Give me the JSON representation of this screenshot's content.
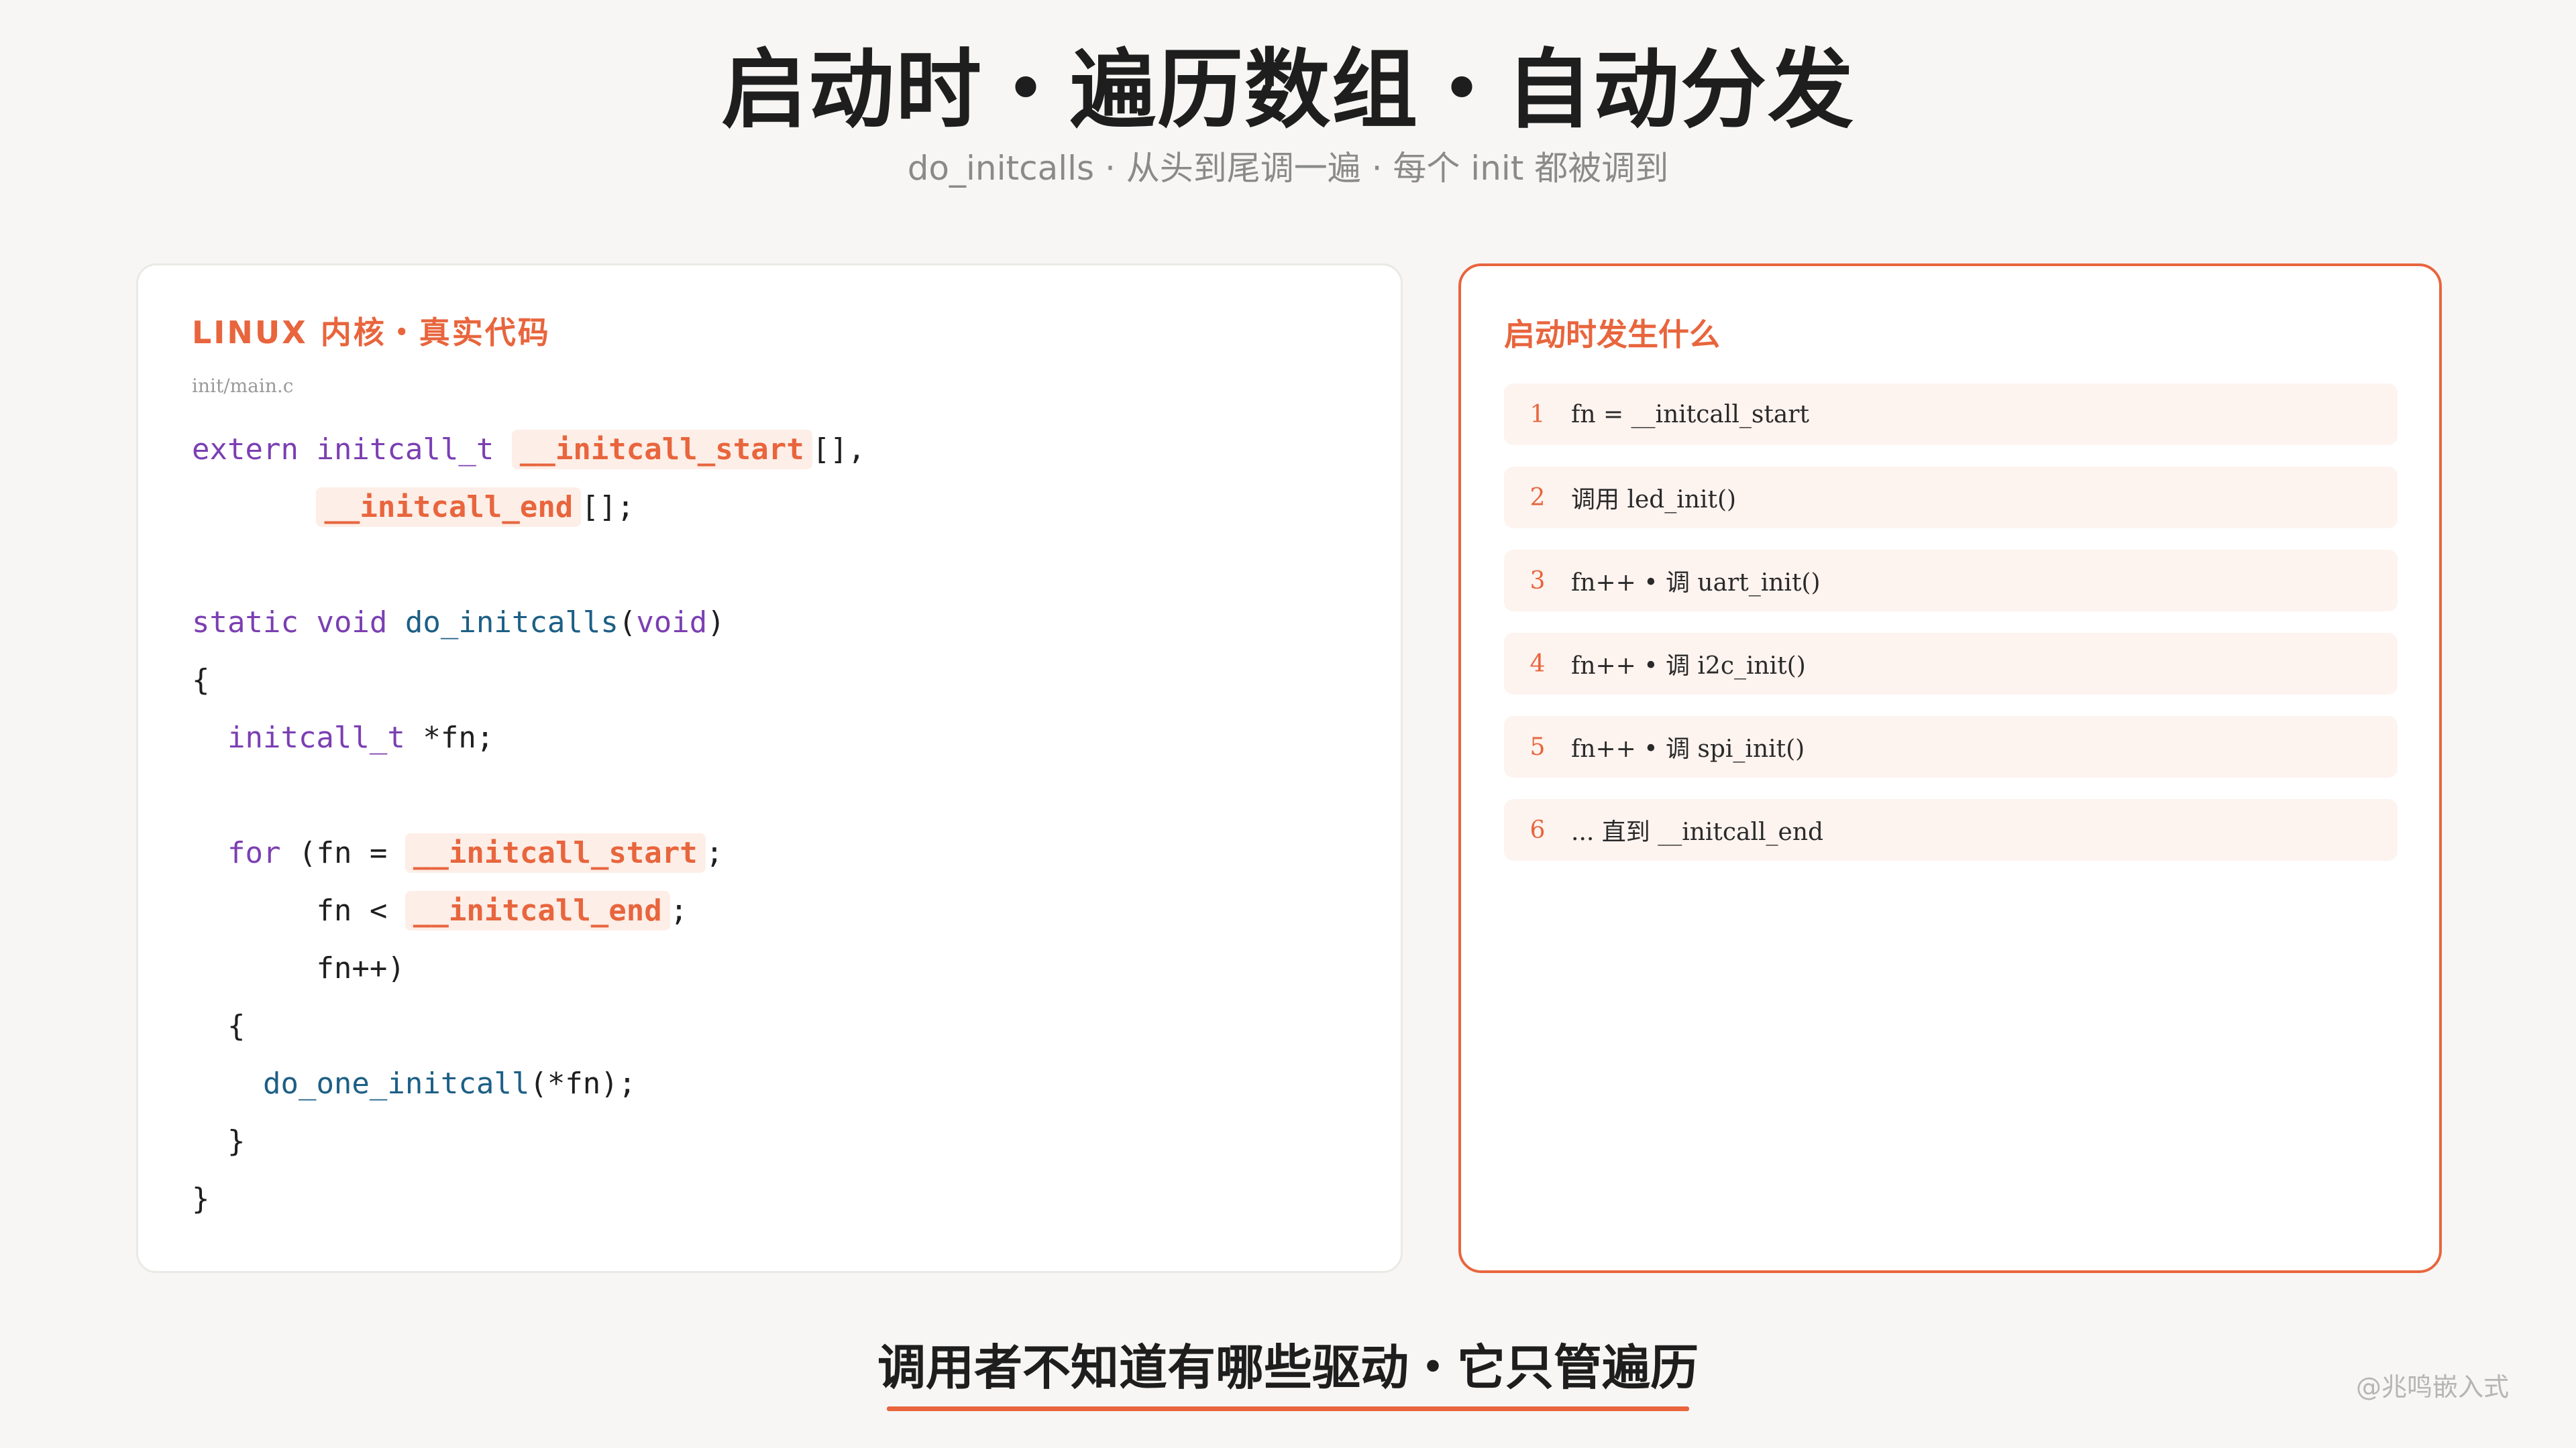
{
  "title": "启动时・遍历数组・自动分发",
  "subtitle": "do_initcalls · 从头到尾调一遍 · 每个 init 都被调到",
  "code_card": {
    "heading": "LINUX 内核・真实代码",
    "file_path": "init/main.c",
    "tokens": {
      "extern": "extern",
      "initcall_t": "initcall_t",
      "initcall_start": "__initcall_start",
      "initcall_end": "__initcall_end",
      "array_comma": "[],",
      "array_semi": "[];",
      "static": "static",
      "void": "void",
      "do_initcalls": "do_initcalls",
      "open_paren": "(",
      "close_paren": ")",
      "open_brace": "{",
      "close_brace": "}",
      "star_fn_semi": "*fn;",
      "for": "for",
      "for_open": "(fn =",
      "semicolon": ";",
      "fn_lt": "fn <",
      "fn_inc": "fn++)",
      "do_one_initcall": "do_one_initcall",
      "call_args": "(*fn);"
    }
  },
  "steps_card": {
    "heading": "启动时发生什么",
    "steps": [
      {
        "num": "1",
        "text": "fn = __initcall_start"
      },
      {
        "num": "2",
        "text": "调用 led_init()"
      },
      {
        "num": "3",
        "text": "fn++ • 调 uart_init()"
      },
      {
        "num": "4",
        "text": "fn++ • 调 i2c_init()"
      },
      {
        "num": "5",
        "text": "fn++ • 调 spi_init()"
      },
      {
        "num": "6",
        "text": "... 直到 __initcall_end"
      }
    ]
  },
  "bottom_text": "调用者不知道有哪些驱动・它只管遍历",
  "watermark": "@兆鸣嵌入式",
  "colors": {
    "accent": "#e8653d",
    "keyword": "#7b3fb2",
    "function": "#1d5f86",
    "highlight_bg": "#fdeee7",
    "background": "#f7f6f4"
  }
}
